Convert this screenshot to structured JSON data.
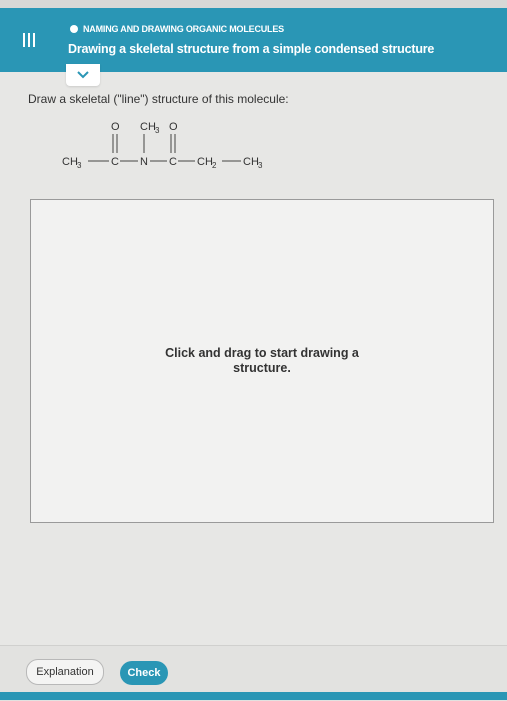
{
  "header": {
    "topic": "NAMING AND DRAWING ORGANIC MOLECULES",
    "title": "Drawing a skeletal structure from a simple condensed structure"
  },
  "question": {
    "prompt": "Draw a skeletal (\"line\") structure of this molecule:",
    "molecule": {
      "ch3_left": "CH",
      "c1": "C",
      "n": "N",
      "c2": "C",
      "ch2": "CH",
      "ch3_right": "CH",
      "o1": "O",
      "ch3_top": "CH",
      "o2": "O",
      "sub3": "3",
      "sub2": "2"
    }
  },
  "canvas": {
    "hint": "Click and drag to start drawing a structure."
  },
  "footer": {
    "explanation_label": "Explanation",
    "check_label": "Check"
  },
  "colors": {
    "accent": "#2a96b5",
    "background": "#e7e7e5"
  }
}
